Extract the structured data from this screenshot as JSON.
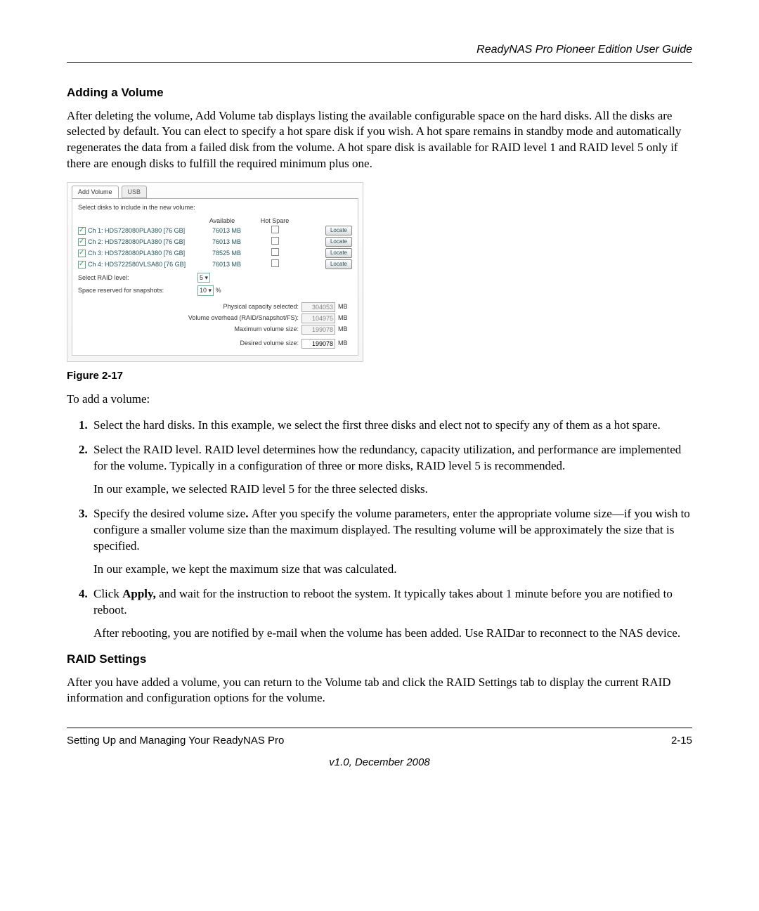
{
  "header": {
    "title": "ReadyNAS Pro Pioneer Edition User Guide"
  },
  "section1": {
    "heading": "Adding a Volume",
    "para1": "After deleting the volume, Add Volume tab displays listing the available configurable space on the hard disks. All the disks are selected by default. You can elect to specify a hot spare disk if you wish. A hot spare remains in standby mode and automatically regenerates the data from a failed disk from the volume. A hot spare disk is available for RAID level 1 and RAID level 5 only if there are enough disks to fulfill the required minimum plus one."
  },
  "screenshot": {
    "tabs": [
      "Add Volume",
      "USB"
    ],
    "instruction": "Select disks to include in the new volume:",
    "cols": {
      "available": "Available",
      "hotspare": "Hot Spare"
    },
    "disks": [
      {
        "chk": true,
        "label": "Ch 1: HDS728080PLA380 [76 GB]",
        "available": "76013 MB"
      },
      {
        "chk": true,
        "label": "Ch 2: HDS728080PLA380 [76 GB]",
        "available": "76013 MB"
      },
      {
        "chk": true,
        "label": "Ch 3: HDS728080PLA380 [76 GB]",
        "available": "78525 MB"
      },
      {
        "chk": true,
        "label": "Ch 4: HDS722580VLSA80 [76 GB]",
        "available": "76013 MB"
      }
    ],
    "locate_label": "Locate",
    "raid": {
      "label": "Select RAID level:",
      "value": "5"
    },
    "snapshot": {
      "label": "Space reserved for snapshots:",
      "value": "10",
      "unit": "%"
    },
    "stats": {
      "phys": {
        "label": "Physical capacity selected:",
        "value": "304053",
        "unit": "MB"
      },
      "over": {
        "label": "Volume overhead (RAID/Snapshot/FS):",
        "value": "104975",
        "unit": "MB"
      },
      "max": {
        "label": "Maximum volume size:",
        "value": "199078",
        "unit": "MB"
      },
      "desired": {
        "label": "Desired volume size:",
        "value": "199078",
        "unit": "MB"
      }
    }
  },
  "figure": {
    "caption": "Figure 2-17"
  },
  "intro_line": "To add a volume:",
  "steps": {
    "s1": "Select the hard disks. In this example, we select the first three disks and elect not to specify any of them as a hot spare.",
    "s2a": "Select the RAID level. RAID level determines how the redundancy, capacity utilization, and performance are implemented for the volume. Typically in a configuration of three or more disks, RAID level 5 is recommended.",
    "s2b": "In our example, we selected RAID level 5 for the three selected disks.",
    "s3a_pre": "Specify the desired volume size",
    "s3a_bolddot": ". ",
    "s3a_post": "After you specify the volume parameters, enter the appropriate volume size—if you wish to configure a smaller volume size than the maximum displayed. The resulting volume will be approximately the size that is specified.",
    "s3b": "In our example, we kept the maximum size that was calculated.",
    "s4_pre": "Click ",
    "s4_bold": "Apply,",
    "s4_post": " and wait for the instruction to reboot the system. It typically takes about 1 minute before you are notified to reboot.",
    "s4b": "After rebooting, you are notified by e-mail when the volume has been added. Use RAIDar to reconnect to the NAS device."
  },
  "section2": {
    "heading": "RAID Settings",
    "para": "After you have added a volume, you can return to the Volume tab and click the RAID Settings tab to display the current RAID information and configuration options for the volume."
  },
  "footer": {
    "left": "Setting Up and Managing Your ReadyNAS Pro",
    "right": "2-15",
    "center": "v1.0, December 2008"
  }
}
